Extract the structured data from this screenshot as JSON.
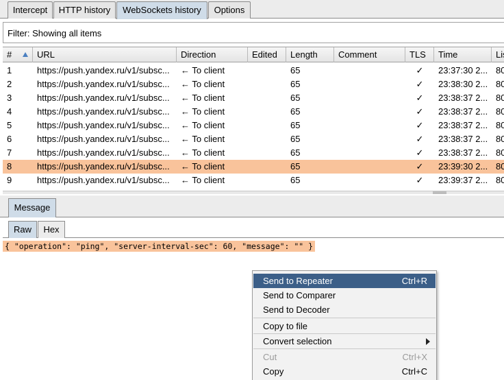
{
  "top_tabs": [
    "Intercept",
    "HTTP history",
    "WebSockets history",
    "Options"
  ],
  "filter": "Filter: Showing all items",
  "columns": [
    "#",
    "URL",
    "Direction",
    "Edited",
    "Length",
    "Comment",
    "TLS",
    "Time",
    "Lis"
  ],
  "rows": [
    {
      "num": "1",
      "url": "https://push.yandex.ru/v1/subsc...",
      "direction": "← To client",
      "edited": "",
      "length": "65",
      "comment": "",
      "tls": "✓",
      "time": "23:37:30 2...",
      "listener": "80"
    },
    {
      "num": "2",
      "url": "https://push.yandex.ru/v1/subsc...",
      "direction": "← To client",
      "edited": "",
      "length": "65",
      "comment": "",
      "tls": "✓",
      "time": "23:38:30 2...",
      "listener": "80"
    },
    {
      "num": "3",
      "url": "https://push.yandex.ru/v1/subsc...",
      "direction": "← To client",
      "edited": "",
      "length": "65",
      "comment": "",
      "tls": "✓",
      "time": "23:38:37 2...",
      "listener": "80"
    },
    {
      "num": "4",
      "url": "https://push.yandex.ru/v1/subsc...",
      "direction": "← To client",
      "edited": "",
      "length": "65",
      "comment": "",
      "tls": "✓",
      "time": "23:38:37 2...",
      "listener": "80"
    },
    {
      "num": "5",
      "url": "https://push.yandex.ru/v1/subsc...",
      "direction": "← To client",
      "edited": "",
      "length": "65",
      "comment": "",
      "tls": "✓",
      "time": "23:38:37 2...",
      "listener": "80"
    },
    {
      "num": "6",
      "url": "https://push.yandex.ru/v1/subsc...",
      "direction": "← To client",
      "edited": "",
      "length": "65",
      "comment": "",
      "tls": "✓",
      "time": "23:38:37 2...",
      "listener": "80"
    },
    {
      "num": "7",
      "url": "https://push.yandex.ru/v1/subsc...",
      "direction": "← To client",
      "edited": "",
      "length": "65",
      "comment": "",
      "tls": "✓",
      "time": "23:38:37 2...",
      "listener": "80"
    },
    {
      "num": "8",
      "url": "https://push.yandex.ru/v1/subsc...",
      "direction": "← To client",
      "edited": "",
      "length": "65",
      "comment": "",
      "tls": "✓",
      "time": "23:39:30 2...",
      "listener": "80"
    },
    {
      "num": "9",
      "url": "https://push.yandex.ru/v1/subsc...",
      "direction": "← To client",
      "edited": "",
      "length": "65",
      "comment": "",
      "tls": "✓",
      "time": "23:39:37 2...",
      "listener": "80"
    }
  ],
  "selected_row": "8",
  "message_tab": "Message",
  "sub_tabs": [
    "Raw",
    "Hex"
  ],
  "payload": "{ \"operation\": \"ping\", \"server-interval-sec\": 60, \"message\": \"\" }",
  "context_menu": {
    "send_repeater": "Send to Repeater",
    "send_repeater_shortcut": "Ctrl+R",
    "send_comparer": "Send to Comparer",
    "send_decoder": "Send to Decoder",
    "copy_file": "Copy to file",
    "convert": "Convert selection",
    "cut": "Cut",
    "cut_shortcut": "Ctrl+X",
    "copy": "Copy",
    "copy_shortcut": "Ctrl+C"
  },
  "colors": {
    "selected_row": "#f9c39b",
    "menu_highlight": "#3c5f88",
    "active_tab": "#cfdce8"
  }
}
